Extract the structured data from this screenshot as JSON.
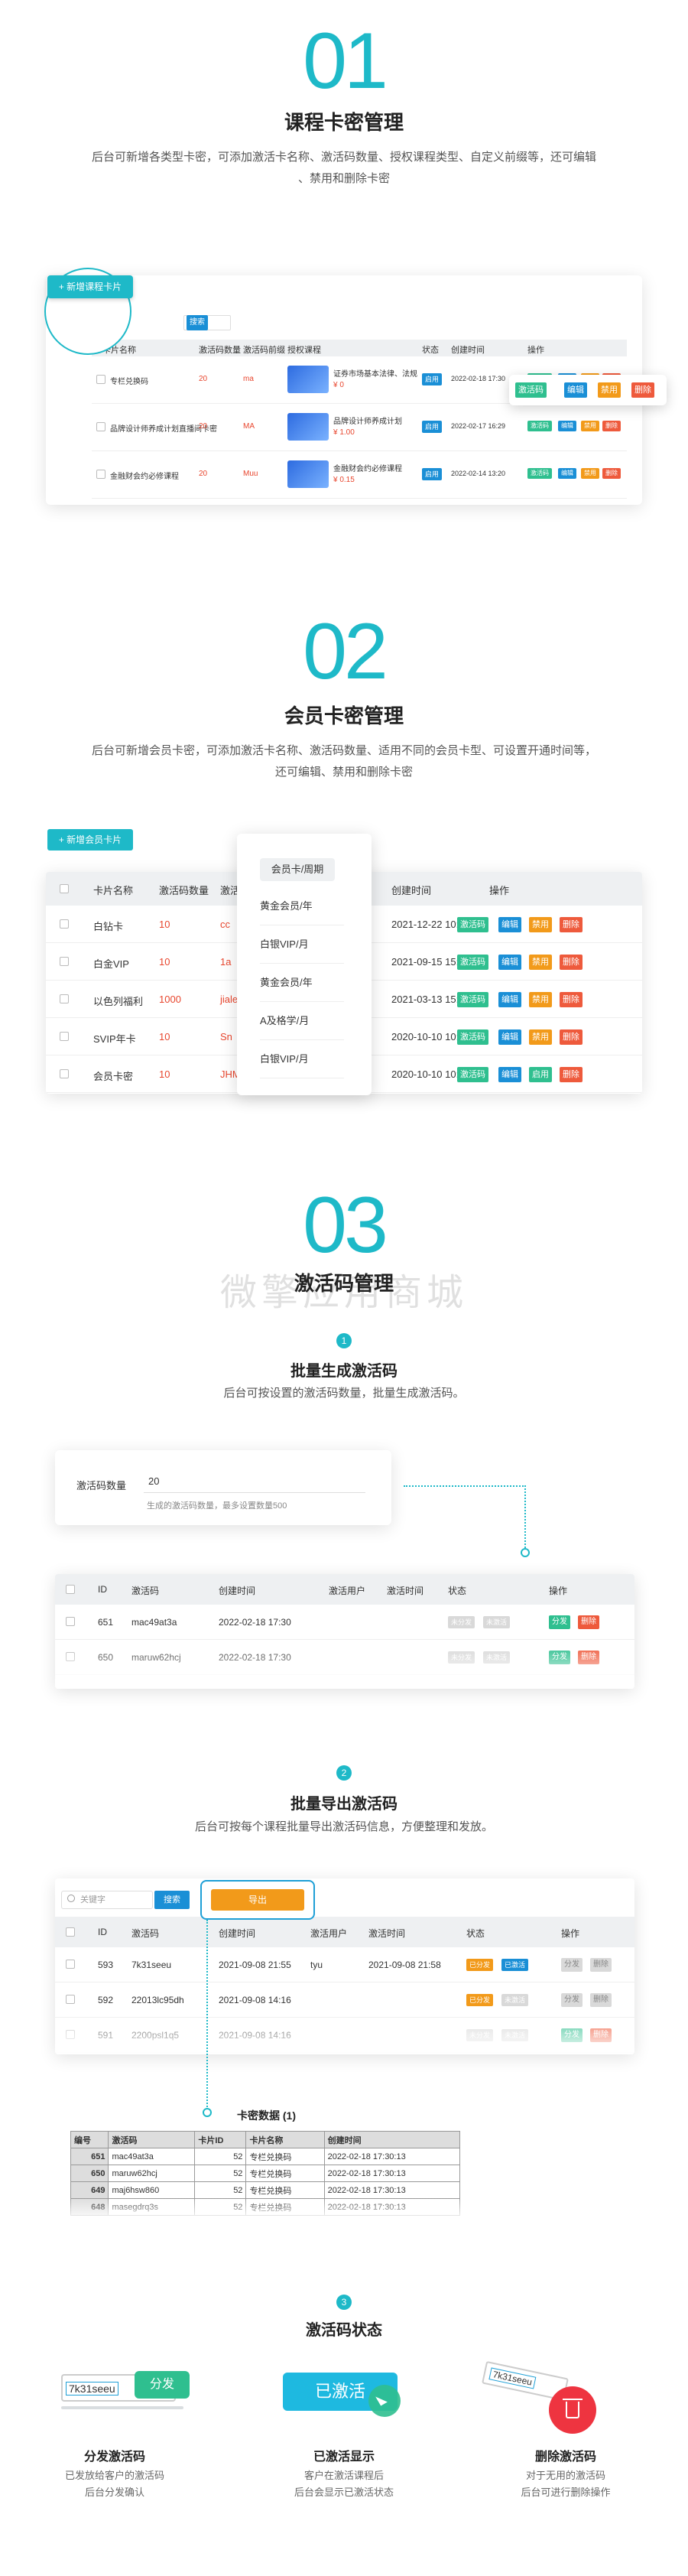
{
  "s1": {
    "num": "01",
    "title": "课程卡密管理",
    "desc1": "后台可新增各类型卡密，可添加激活卡名称、激活码数量、授权课程类型、自定义前缀等，还可编辑",
    "desc2": "、禁用和删除卡密",
    "add_btn": "+ 新增课程卡片",
    "search_btn": "搜索",
    "headers": [
      "卡片名称",
      "激活码数量",
      "激活码前缀",
      "授权课程",
      "状态",
      "创建时间",
      "操作"
    ],
    "rows": [
      {
        "name": "专栏兑换码",
        "count": "20",
        "prefix": "ma",
        "course": "证券市场基本法律、法规",
        "price": "¥ 0",
        "status": "启用",
        "time": "2022-02-18 17:30"
      },
      {
        "name": "品牌设计师养成计划直播间卡密",
        "count": "20",
        "prefix": "MA",
        "course": "品牌设计师养成计划",
        "price": "¥ 1.00",
        "status": "启用",
        "time": "2022-02-17 16:29"
      },
      {
        "name": "金融财会约必修课程",
        "count": "20",
        "prefix": "Muu",
        "course": "金融财会约必修课程",
        "price": "¥ 0.15",
        "status": "启用",
        "time": "2022-02-14 13:20"
      }
    ],
    "ops": [
      "激活码",
      "编辑",
      "禁用",
      "删除"
    ]
  },
  "s2": {
    "num": "02",
    "title": "会员卡密管理",
    "desc1": "后台可新增会员卡密，可添加激活卡名称、激活码数量、适用不同的会员卡型、可设置开通时间等，",
    "desc2": "还可编辑、禁用和删除卡密",
    "add_btn": "+ 新增会员卡片",
    "headers": [
      "卡片名称",
      "激活码数量",
      "激活",
      "创建时间",
      "操作"
    ],
    "rows": [
      {
        "name": "白钻卡",
        "count": "10",
        "prefix": "cc",
        "time": "2021-12-22 10:07",
        "toggle": "禁用"
      },
      {
        "name": "白金VIP",
        "count": "10",
        "prefix": "1a",
        "time": "2021-09-15 15:53",
        "toggle": "禁用"
      },
      {
        "name": "以色列福利",
        "count": "1000",
        "prefix": "jiale",
        "time": "2021-03-13 15:09",
        "toggle": "禁用"
      },
      {
        "name": "SVIP年卡",
        "count": "10",
        "prefix": "Sn",
        "time": "2020-10-10 10:46",
        "toggle": "禁用"
      },
      {
        "name": "会员卡密",
        "count": "10",
        "prefix": "JHM",
        "time": "2020-10-10 10:08",
        "toggle": "启用"
      }
    ],
    "ops": [
      "激活码",
      "编辑",
      "删除"
    ],
    "dropdown": {
      "title": "会员卡/周期",
      "items": [
        "黄金会员/年",
        "白银VIP/月",
        "黄金会员/年",
        "A及格学/月",
        "白银VIP/月"
      ]
    }
  },
  "s3": {
    "num": "03",
    "title": "激活码管理",
    "watermark": "微擎应用商城",
    "step1": {
      "dot": "1",
      "title": "批量生成激活码",
      "desc": "后台可按设置的激活码数量，批量生成激活码。"
    },
    "form": {
      "label": "激活码数量",
      "value": "20",
      "hint": "生成的激活码数量，最多设置数量500"
    },
    "t1": {
      "headers": [
        "ID",
        "激活码",
        "创建时间",
        "激活用户",
        "激活时间",
        "状态",
        "操作"
      ],
      "rows": [
        {
          "id": "651",
          "code": "mac49at3a",
          "time": "2022-02-18 17:30",
          "s1": "未分发",
          "s2": "未激活"
        },
        {
          "id": "650",
          "code": "maruw62hcj",
          "time": "2022-02-18 17:30",
          "s1": "未分发",
          "s2": "未激活"
        }
      ],
      "ops": [
        "分发",
        "删除"
      ]
    },
    "step2": {
      "dot": "2",
      "title": "批量导出激活码",
      "desc": "后台可按每个课程批量导出激活码信息，方便整理和发放。"
    },
    "t2": {
      "search_placeholder": "关键字",
      "search_btn": "搜索",
      "export_btn": "导出",
      "headers": [
        "ID",
        "激活码",
        "创建时间",
        "激活用户",
        "激活时间",
        "状态",
        "操作"
      ],
      "rows": [
        {
          "id": "593",
          "code": "7k31seeu",
          "time": "2021-09-08 21:55",
          "user": "tyu",
          "atime": "2021-09-08 21:58",
          "s1": "已分发",
          "s2": "已激活"
        },
        {
          "id": "592",
          "code": "22013lc95dh",
          "time": "2021-09-08 14:16",
          "user": "",
          "atime": "",
          "s1": "已分发",
          "s2": "未激活"
        },
        {
          "id": "591",
          "code": "2200psl1q5",
          "time": "2021-09-08 14:16",
          "user": "",
          "atime": "",
          "s1": "未分发",
          "s2": "未激活"
        }
      ],
      "ops": [
        "分发",
        "删除"
      ]
    },
    "sheet": {
      "title": "卡密数据 (1)",
      "headers": [
        "编号",
        "激活码",
        "卡片ID",
        "卡片名称",
        "创建时间"
      ],
      "rows": [
        [
          "651",
          "mac49at3a",
          "52",
          "专栏兑换码",
          "2022-02-18 17:30:13"
        ],
        [
          "650",
          "maruw62hcj",
          "52",
          "专栏兑换码",
          "2022-02-18 17:30:13"
        ],
        [
          "649",
          "maj6hsw860",
          "52",
          "专栏兑换码",
          "2022-02-18 17:30:13"
        ],
        [
          "648",
          "masegdrq3s",
          "52",
          "专栏兑换码",
          "2022-02-18 17:30:13"
        ]
      ]
    },
    "step3": {
      "dot": "3",
      "title": "激活码状态"
    },
    "states": [
      {
        "title": "分发激活码",
        "d1": "已发放给客户的激活码",
        "d2": "后台分发确认",
        "code": "7k31seeu",
        "btn": "分发"
      },
      {
        "title": "已激活显示",
        "d1": "客户在激活课程后",
        "d2": "后台会显示已激活状态",
        "btn": "已激活"
      },
      {
        "title": "删除激活码",
        "d1": "对于无用的激活码",
        "d2": "后台可进行删除操作",
        "code": "7k31seeu"
      }
    ]
  },
  "colors": {
    "accent": "#1eb9c8",
    "green": "#2fbf8f",
    "blue": "#1a8fd6",
    "orange": "#f29a1a",
    "red": "#ee5a3c"
  }
}
